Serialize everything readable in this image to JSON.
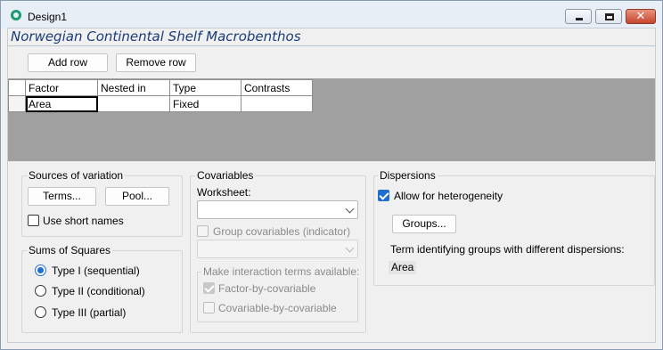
{
  "window": {
    "title": "Design1",
    "design_title": "Norwegian Continental Shelf Macrobenthos"
  },
  "toolbar": {
    "add_row_label": "Add row",
    "remove_row_label": "Remove row"
  },
  "grid": {
    "columns": [
      "Factor",
      "Nested in",
      "Type",
      "Contrasts"
    ],
    "rows": [
      {
        "factor": "Area",
        "nested_in": "",
        "type": "Fixed",
        "contrasts": ""
      }
    ]
  },
  "sources": {
    "group_label": "Sources of variation",
    "terms_label": "Terms...",
    "pool_label": "Pool...",
    "short_names_label": "Use short names",
    "short_names_checked": false
  },
  "sums": {
    "group_label": "Sums of Squares",
    "options": [
      "Type I (sequential)",
      "Type II (conditional)",
      "Type III (partial)"
    ],
    "selected": "Type I (sequential)"
  },
  "covariables": {
    "group_label": "Covariables",
    "worksheet_label": "Worksheet:",
    "worksheet_value": "",
    "group_cov_label": "Group covariables (indicator)",
    "group_cov_value": "",
    "interaction_label": "Make interaction terms available:",
    "factor_by_cov_label": "Factor-by-covariable",
    "factor_by_cov_checked": true,
    "cov_by_cov_label": "Covariable-by-covariable",
    "cov_by_cov_checked": false
  },
  "dispersions": {
    "group_label": "Dispersions",
    "heterogeneity_label": "Allow for heterogeneity",
    "heterogeneity_checked": true,
    "groups_label": "Groups...",
    "term_label": "Term identifying groups with different dispersions:",
    "term_value": "Area"
  },
  "colors": {
    "accent": "#1f6fd0",
    "title_text": "#1a3c79",
    "grid_background": "#a0a0a0"
  }
}
